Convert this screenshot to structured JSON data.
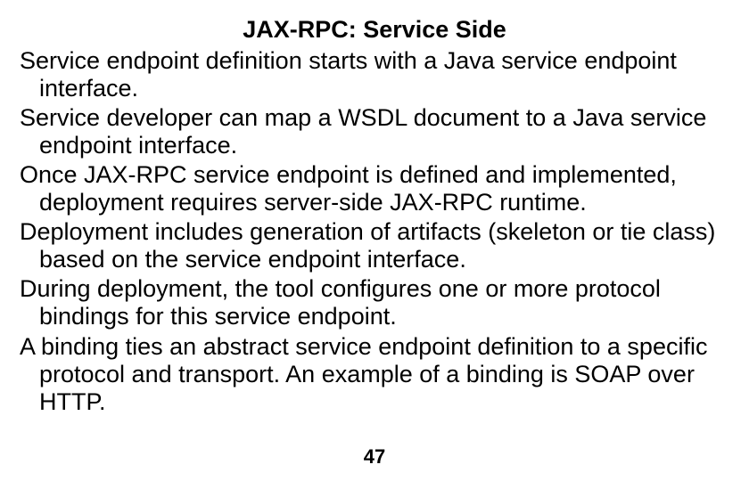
{
  "slide": {
    "title": "JAX-RPC:  Service Side",
    "paragraphs": [
      "Service endpoint definition starts with a Java service endpoint interface.",
      "Service developer can map a WSDL document to a Java service endpoint interface.",
      "Once JAX-RPC service endpoint is defined and implemented, deployment requires server-side JAX-RPC runtime.",
      "Deployment includes generation of artifacts (skeleton or tie class) based on the service endpoint interface.",
      "During deployment, the tool configures one or more protocol bindings for this service endpoint.",
      "A binding ties an abstract service endpoint definition to a specific protocol and transport. An example of a binding is SOAP over HTTP."
    ],
    "page_number": "47"
  }
}
